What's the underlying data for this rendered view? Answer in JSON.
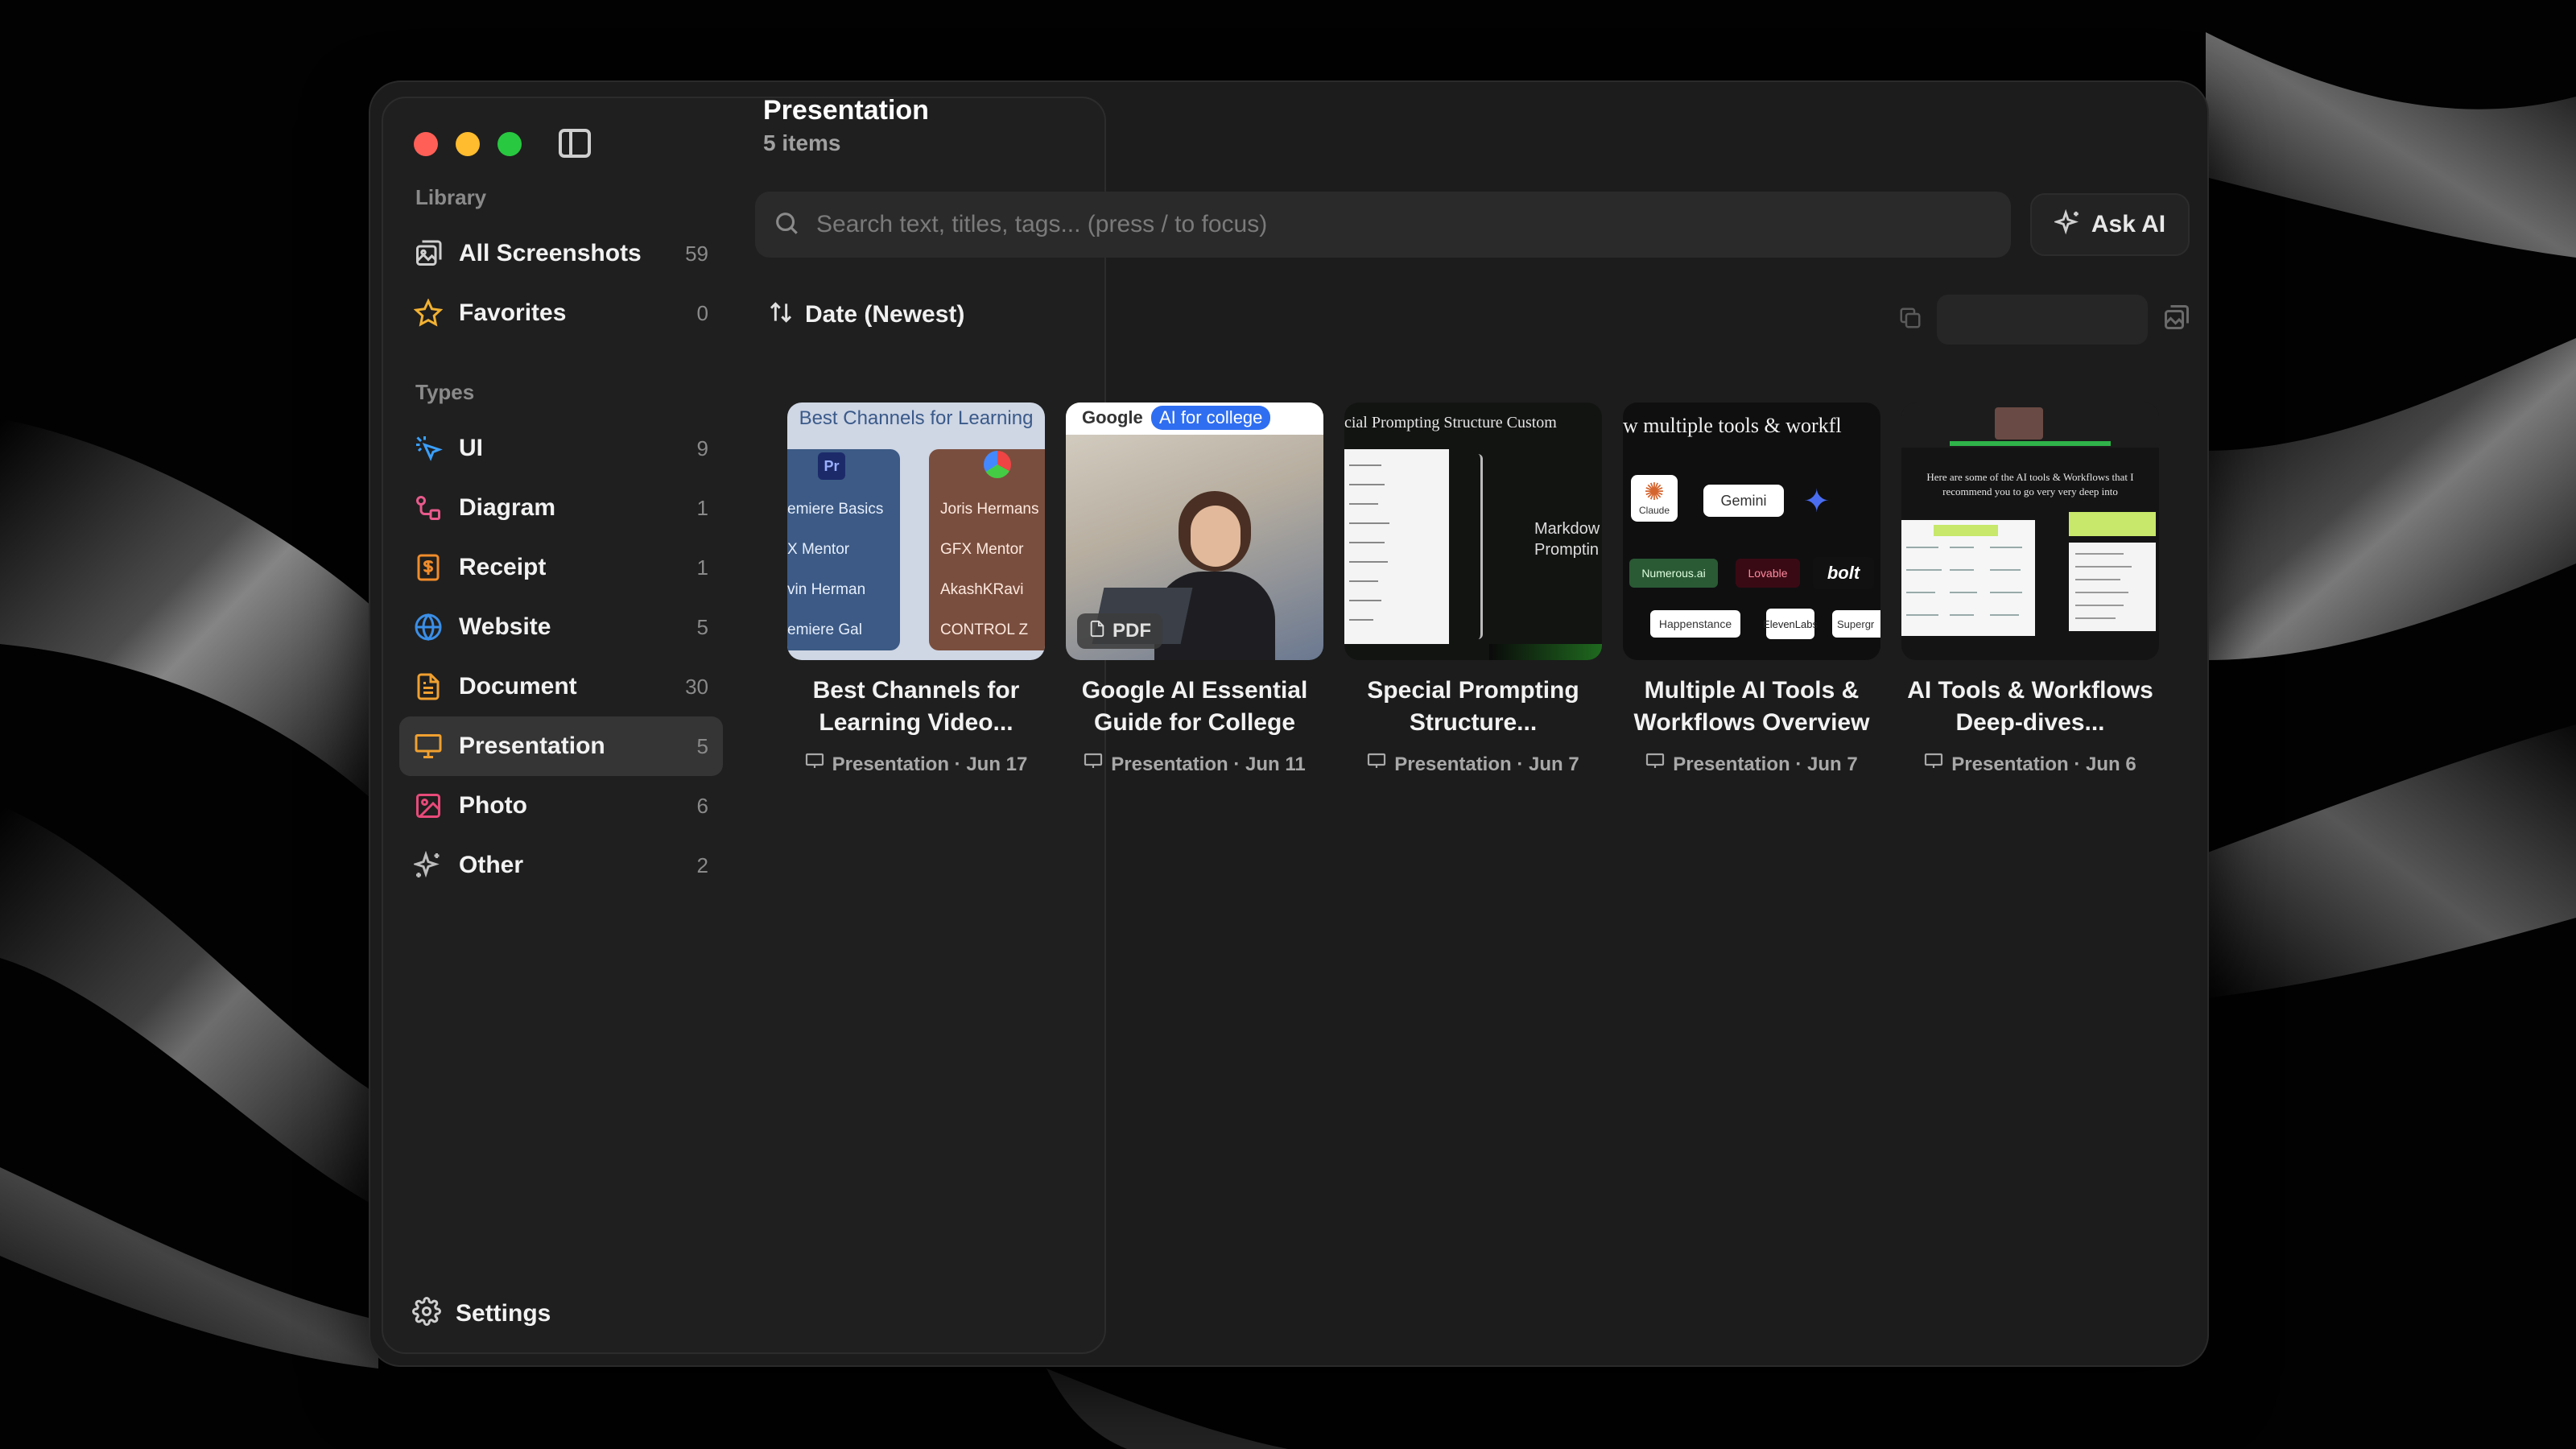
{
  "window": {
    "header_title": "Presentation",
    "header_subtitle": "5 items"
  },
  "sidebar": {
    "library_label": "Library",
    "types_label": "Types",
    "library_items": [
      {
        "label": "All Screenshots",
        "count": "59",
        "icon": "screenshots-icon"
      },
      {
        "label": "Favorites",
        "count": "0",
        "icon": "star-icon"
      }
    ],
    "type_items": [
      {
        "label": "UI",
        "count": "9",
        "icon": "cursor-click-icon"
      },
      {
        "label": "Diagram",
        "count": "1",
        "icon": "diagram-icon"
      },
      {
        "label": "Receipt",
        "count": "1",
        "icon": "receipt-icon"
      },
      {
        "label": "Website",
        "count": "5",
        "icon": "globe-icon"
      },
      {
        "label": "Document",
        "count": "30",
        "icon": "document-icon"
      },
      {
        "label": "Presentation",
        "count": "5",
        "icon": "presentation-icon",
        "active": true
      },
      {
        "label": "Photo",
        "count": "6",
        "icon": "photo-icon"
      },
      {
        "label": "Other",
        "count": "2",
        "icon": "sparkles-icon"
      }
    ],
    "settings_label": "Settings"
  },
  "search": {
    "placeholder": "Search text, titles, tags... (press / to focus)",
    "value": ""
  },
  "ask_ai_label": "Ask AI",
  "sort_label": "Date (Newest)",
  "cards": [
    {
      "title_line1": "Best Channels for",
      "title_line2": "Learning Video...",
      "meta": "Presentation · Jun 17",
      "thumb_heading": "Best Channels for Learning",
      "thumb_left": [
        "emiere Basics",
        "X Mentor",
        "vin Herman",
        "emiere Gal"
      ],
      "thumb_right": [
        "Joris Hermans",
        "GFX Mentor",
        "AkashKRavi",
        "CONTROL Z"
      ]
    },
    {
      "title_line1": "Google AI Essential",
      "title_line2": "Guide for College",
      "meta": "Presentation · Jun 11",
      "thumb_google": "Google",
      "thumb_tag": "AI for college",
      "pdf_label": "PDF"
    },
    {
      "title_line1": "Special Prompting",
      "title_line2": "Structure...",
      "meta": "Presentation · Jun 7",
      "thumb_heading": "cial Prompting Structure Custom",
      "thumb_side": "Markdow\nPromptin"
    },
    {
      "title_line1": "Multiple AI Tools &",
      "title_line2": "Workflows Overview",
      "meta": "Presentation · Jun 7",
      "thumb_heading": "w multiple tools & workfl",
      "thumb_tools": [
        "Claude",
        "Gemini",
        "Numerous.ai",
        "Lovable",
        "bolt",
        "Happenstance",
        "ElevenLabs",
        "Supergr"
      ]
    },
    {
      "title_line1": "AI Tools & Workflows",
      "title_line2": "Deep-dives...",
      "meta": "Presentation · Jun 6",
      "thumb_heading": "Here are some of the AI tools & Workflows that I recommend you to go very very deep into"
    }
  ],
  "colors": {
    "accent_active": "#353535",
    "traffic_red": "#ff5f57",
    "traffic_yellow": "#febc2e",
    "traffic_green": "#28c840"
  }
}
